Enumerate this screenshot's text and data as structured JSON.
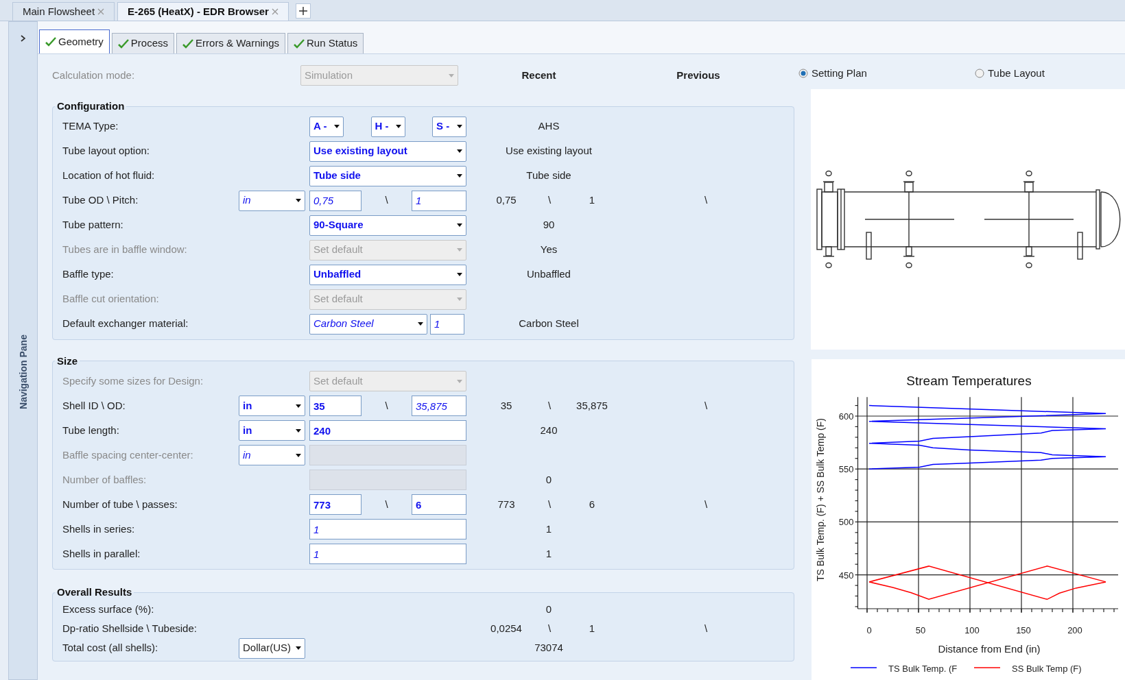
{
  "document_tabs": [
    {
      "label": "Main Flowsheet",
      "selected": false
    },
    {
      "label": "E-265 (HeatX) - EDR Browser",
      "selected": true
    }
  ],
  "navigation_pane": {
    "title": "Navigation Pane"
  },
  "tabs": [
    {
      "label": "Geometry",
      "selected": true
    },
    {
      "label": "Process",
      "selected": false
    },
    {
      "label": "Errors & Warnings",
      "selected": false
    },
    {
      "label": "Run Status",
      "selected": false
    }
  ],
  "calculation_mode": {
    "label": "Calculation mode:",
    "value": "Simulation",
    "disabled": true
  },
  "column_headers": {
    "recent": "Recent",
    "previous": "Previous"
  },
  "groups": [
    {
      "title": "Configuration",
      "rows": [
        {
          "label": "TEMA Type:",
          "disabled": false,
          "kind": "tema",
          "controls": [
            {
              "kind": "dropdown",
              "value": "A -",
              "bold": true,
              "italic": false,
              "disabled": false
            },
            {
              "kind": "dropdown",
              "value": "H -",
              "bold": true,
              "italic": false,
              "disabled": false
            },
            {
              "kind": "dropdown",
              "value": "S -",
              "bold": true,
              "italic": false,
              "disabled": false
            }
          ],
          "recent": [
            "AHS"
          ]
        },
        {
          "label": "Tube layout option:",
          "disabled": false,
          "kind": "single",
          "controls": [
            {
              "kind": "dropdown",
              "value": "Use existing layout",
              "bold": true,
              "italic": false,
              "disabled": false
            }
          ],
          "recent": [
            "Use existing layout"
          ]
        },
        {
          "label": "Location of hot fluid:",
          "disabled": false,
          "kind": "single",
          "controls": [
            {
              "kind": "dropdown",
              "value": "Tube side",
              "bold": true,
              "italic": false,
              "disabled": false
            }
          ],
          "recent": [
            "Tube side"
          ]
        },
        {
          "label": "Tube OD \\ Pitch:",
          "disabled": false,
          "kind": "pair",
          "unit": {
            "kind": "dropdown",
            "value": "in",
            "bold": false,
            "italic": true,
            "disabled": false
          },
          "controls": [
            {
              "kind": "input",
              "value": "0,75",
              "bold": false,
              "italic": true,
              "disabled": false
            },
            {
              "kind": "separator",
              "value": "\\"
            },
            {
              "kind": "input",
              "value": "1",
              "bold": false,
              "italic": true,
              "disabled": false
            }
          ],
          "recent": [
            "0,75",
            "\\",
            "1"
          ],
          "previous": [
            "\\"
          ]
        },
        {
          "label": "Tube pattern:",
          "disabled": false,
          "kind": "single",
          "controls": [
            {
              "kind": "dropdown",
              "value": "90-Square",
              "bold": true,
              "italic": false,
              "disabled": false
            }
          ],
          "recent": [
            "90"
          ]
        },
        {
          "label": "Tubes are in baffle window:",
          "disabled": true,
          "kind": "single",
          "controls": [
            {
              "kind": "dropdown",
              "value": "Set default",
              "bold": false,
              "italic": false,
              "disabled": true
            }
          ],
          "recent": [
            "Yes"
          ]
        },
        {
          "label": "Baffle type:",
          "disabled": false,
          "kind": "single",
          "controls": [
            {
              "kind": "dropdown",
              "value": "Unbaffled",
              "bold": true,
              "italic": false,
              "disabled": false
            }
          ],
          "recent": [
            "Unbaffled"
          ]
        },
        {
          "label": "Baffle cut orientation:",
          "disabled": true,
          "kind": "single",
          "controls": [
            {
              "kind": "dropdown",
              "value": "Set default",
              "bold": false,
              "italic": false,
              "disabled": true
            }
          ]
        },
        {
          "label": "Default exchanger material:",
          "disabled": false,
          "kind": "material",
          "controls": [
            {
              "kind": "dropdown",
              "value": "Carbon Steel",
              "bold": false,
              "italic": true,
              "disabled": false
            },
            {
              "kind": "input",
              "value": "1",
              "bold": false,
              "italic": true,
              "disabled": false
            }
          ],
          "recent": [
            "Carbon Steel"
          ]
        }
      ]
    },
    {
      "title": "Size",
      "rows": [
        {
          "label": "Specify some sizes for Design:",
          "disabled": true,
          "kind": "single",
          "controls": [
            {
              "kind": "dropdown",
              "value": "Set default",
              "bold": false,
              "italic": false,
              "disabled": true
            }
          ]
        },
        {
          "label": "Shell ID \\ OD:",
          "disabled": false,
          "kind": "pair",
          "unit": {
            "kind": "dropdown",
            "value": "in",
            "bold": true,
            "italic": false,
            "disabled": false
          },
          "controls": [
            {
              "kind": "input",
              "value": "35",
              "bold": true,
              "italic": false,
              "disabled": false
            },
            {
              "kind": "separator",
              "value": "\\"
            },
            {
              "kind": "input",
              "value": "35,875",
              "bold": false,
              "italic": true,
              "disabled": false
            }
          ],
          "recent": [
            "35",
            "\\",
            "35,875"
          ],
          "previous": [
            "\\"
          ]
        },
        {
          "label": "Tube length:",
          "disabled": false,
          "kind": "single",
          "unit": {
            "kind": "dropdown",
            "value": "in",
            "bold": true,
            "italic": false,
            "disabled": false
          },
          "controls": [
            {
              "kind": "input",
              "value": "240",
              "bold": true,
              "italic": false,
              "disabled": false
            }
          ],
          "recent": [
            "240"
          ]
        },
        {
          "label": "Baffle spacing center-center:",
          "disabled": true,
          "kind": "single",
          "unit": {
            "kind": "dropdown",
            "value": "in",
            "bold": false,
            "italic": true,
            "disabled": false
          },
          "controls": [
            {
              "kind": "input",
              "disabled": true
            }
          ]
        },
        {
          "label": "Number of baffles:",
          "disabled": true,
          "kind": "single",
          "controls": [
            {
              "kind": "input",
              "disabled": true
            }
          ],
          "recent": [
            "0"
          ]
        },
        {
          "label": "Number of tube \\ passes:",
          "disabled": false,
          "kind": "pair",
          "controls": [
            {
              "kind": "input",
              "value": "773",
              "bold": true,
              "italic": false,
              "disabled": false
            },
            {
              "kind": "separator",
              "value": "\\"
            },
            {
              "kind": "input",
              "value": "6",
              "bold": true,
              "italic": false,
              "disabled": false
            }
          ],
          "recent": [
            "773",
            "\\",
            "6"
          ],
          "previous": [
            "\\"
          ]
        },
        {
          "label": "Shells in series:",
          "disabled": false,
          "kind": "single",
          "controls": [
            {
              "kind": "input",
              "value": "1",
              "bold": false,
              "italic": true,
              "disabled": false
            }
          ],
          "recent": [
            "1"
          ]
        },
        {
          "label": "Shells in parallel:",
          "disabled": false,
          "kind": "single",
          "controls": [
            {
              "kind": "input",
              "value": "1",
              "bold": false,
              "italic": true,
              "disabled": false
            }
          ],
          "recent": [
            "1"
          ]
        }
      ]
    },
    {
      "title": "Overall Results",
      "rows": [
        {
          "label": "Excess surface (%):",
          "disabled": false,
          "kind": "none",
          "recent": [
            "0"
          ]
        },
        {
          "label": "Dp-ratio Shellside \\ Tubeside:",
          "disabled": false,
          "kind": "none",
          "recent": [
            "0,0254",
            "\\",
            "1"
          ],
          "previous": [
            "\\"
          ]
        },
        {
          "label": "Total cost (all shells):",
          "disabled": false,
          "kind": "none",
          "unit": {
            "kind": "dropdown",
            "value": "Dollar(US)",
            "bold": false,
            "italic": false,
            "disabled": false
          },
          "recent": [
            "73074"
          ]
        }
      ]
    }
  ],
  "view_options": [
    {
      "label": "Setting Plan",
      "selected": true
    },
    {
      "label": "Tube Layout",
      "selected": false
    }
  ],
  "chart": {
    "chart_data": {
      "type": "line",
      "title": "Stream Temperatures",
      "xlabel": "Distance from End (in)",
      "ylabel": "TS Bulk Temp. (F) + SS Bulk Temp (F)",
      "xlim": [
        -9,
        244
      ],
      "ylim": [
        418,
        618
      ],
      "xticks": [
        {
          "value": 0,
          "label": "0"
        },
        {
          "value": 50,
          "label": "50"
        },
        {
          "value": 100,
          "label": "100"
        },
        {
          "value": 150,
          "label": "150"
        },
        {
          "value": 200,
          "label": "200"
        }
      ],
      "yticks": [
        450,
        500,
        550,
        600
      ],
      "grid": true,
      "legend": "bottom",
      "series": [
        {
          "name": "TS Bulk Temp. (F",
          "color": "#0000ff",
          "x": [
            2,
            232,
            2,
            232,
            180,
            169,
            100,
            64,
            51,
            2,
            51,
            64,
            100,
            169,
            180,
            232,
            180,
            169,
            100,
            64,
            51,
            2
          ],
          "values": [
            610,
            602.4,
            595,
            588,
            586.4,
            584,
            580.6,
            579,
            576.3,
            574.3,
            572.5,
            570,
            568,
            565.5,
            563.4,
            561.6,
            560,
            558.4,
            555.7,
            554.4,
            551.8,
            550
          ]
        },
        {
          "name": "SS Bulk Temp (F)",
          "color": "#ff0000",
          "x": [
            2,
            60,
            175,
            187,
            203,
            232,
            null,
            2,
            25,
            43,
            60,
            175,
            232
          ],
          "values": [
            443.3,
            458.2,
            426.9,
            432.7,
            437.5,
            443.3,
            null,
            443.3,
            438,
            433,
            426.9,
            458.2,
            443.3
          ]
        }
      ]
    }
  }
}
